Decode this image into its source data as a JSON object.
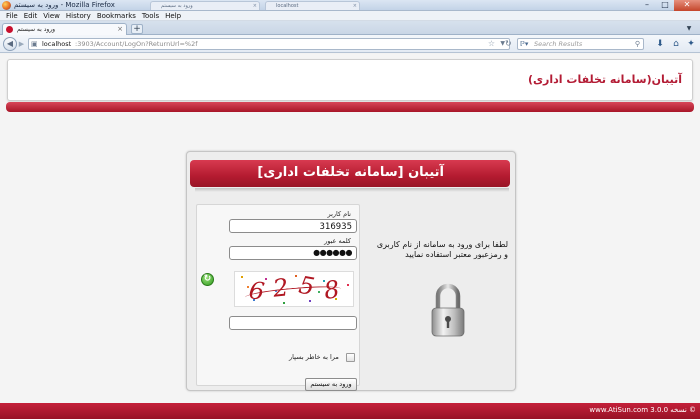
{
  "browser": {
    "window_title": "ورود به سیستم - Mozilla Firefox",
    "menu": [
      "File",
      "Edit",
      "View",
      "History",
      "Bookmarks",
      "Tools",
      "Help"
    ],
    "active_tab_title": "ورود به سیستم",
    "ghost_tabs": [
      "ورود به سیستم",
      "localhost"
    ],
    "url_host": "localhost",
    "url_path": ":3903/Account/LogOn?ReturnUrl=%2f",
    "search_placeholder": "Search Results"
  },
  "header": {
    "site_title": "آتیبان(سامانه تخلفات اداری)"
  },
  "login": {
    "panel_title": "آتیبان [سامانه تخلفات اداری]",
    "username_label": "نام کاربر",
    "username_value": "316935",
    "password_label": "کلمه عبور",
    "password_mask": "●●●●●●",
    "captcha_digits": [
      "6",
      "2",
      "5",
      "8"
    ],
    "remember_label": "مرا به خاطر بسپار",
    "submit_label": "ورود به سیستم",
    "instruction": "لطفا برای ورود به سامانه از نام کاربری و رمزعبور معتبر استفاده نمایید"
  },
  "footer": {
    "copyright": "© نسخه 3.0.0 www.AtiSun.com"
  },
  "colors": {
    "brand_red": "#b31b34",
    "band_red": "#c4203a",
    "captcha_red": "#b01722"
  }
}
